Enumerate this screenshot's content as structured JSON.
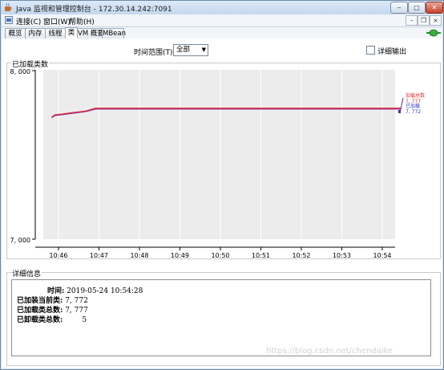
{
  "window": {
    "title": "Java 监视和管理控制台 - 172.30.14.242:7091"
  },
  "menu": {
    "items": [
      "连接(C)",
      "窗口(W)",
      "帮助(H)"
    ]
  },
  "tabs": [
    "概览",
    "内存",
    "线程",
    "类",
    "VM 概要",
    "MBean"
  ],
  "active_tab": "类",
  "controls": {
    "time_range_label": "时间范围(T):",
    "time_range_value": "全部",
    "verbose_label": "详细输出",
    "verbose_checked": false
  },
  "chart_group_title": "已加载类数",
  "details_group_title": "详细信息",
  "details": {
    "time_label": "时间:",
    "time_value": "2019-05-24 10:54:28",
    "current_loaded_label": "已加装当前类:",
    "current_loaded_value": "7, 772",
    "total_loaded_label": "已加载类总数:",
    "total_loaded_value": "7, 777",
    "total_unloaded_label": "已卸载类总数:",
    "total_unloaded_value": "5"
  },
  "legend": {
    "loaded_label": "加载总数",
    "loaded_value": "7, 777",
    "current_label": "已加载",
    "current_value": "7, 772"
  },
  "watermark": "https://blog.csdn.net/chendaike",
  "colors": {
    "total_loaded": "#e03131",
    "current_loaded": "#3333cc",
    "combined_line": "#a0308a"
  },
  "chart_data": {
    "type": "line",
    "y_tick_labels": [
      "8, 000",
      "7, 000"
    ],
    "ylim": [
      7000,
      8000
    ],
    "x_tick_labels": [
      "10:46",
      "10:47",
      "10:48",
      "10:49",
      "10:50",
      "10:51",
      "10:52",
      "10:53",
      "10:54"
    ],
    "grid": true,
    "legend_placement": "right",
    "series": [
      {
        "name": "加载总数",
        "x": [
          "10:45:50",
          "10:45:55",
          "10:46:05",
          "10:46:20",
          "10:46:40",
          "10:46:55",
          "10:54:28"
        ],
        "values": [
          7725,
          7738,
          7742,
          7750,
          7760,
          7777,
          7777
        ]
      },
      {
        "name": "已加载",
        "x": [
          "10:45:50",
          "10:45:55",
          "10:46:05",
          "10:46:20",
          "10:46:40",
          "10:46:55",
          "10:54:28"
        ],
        "values": [
          7720,
          7734,
          7738,
          7746,
          7756,
          7772,
          7772
        ]
      }
    ]
  }
}
